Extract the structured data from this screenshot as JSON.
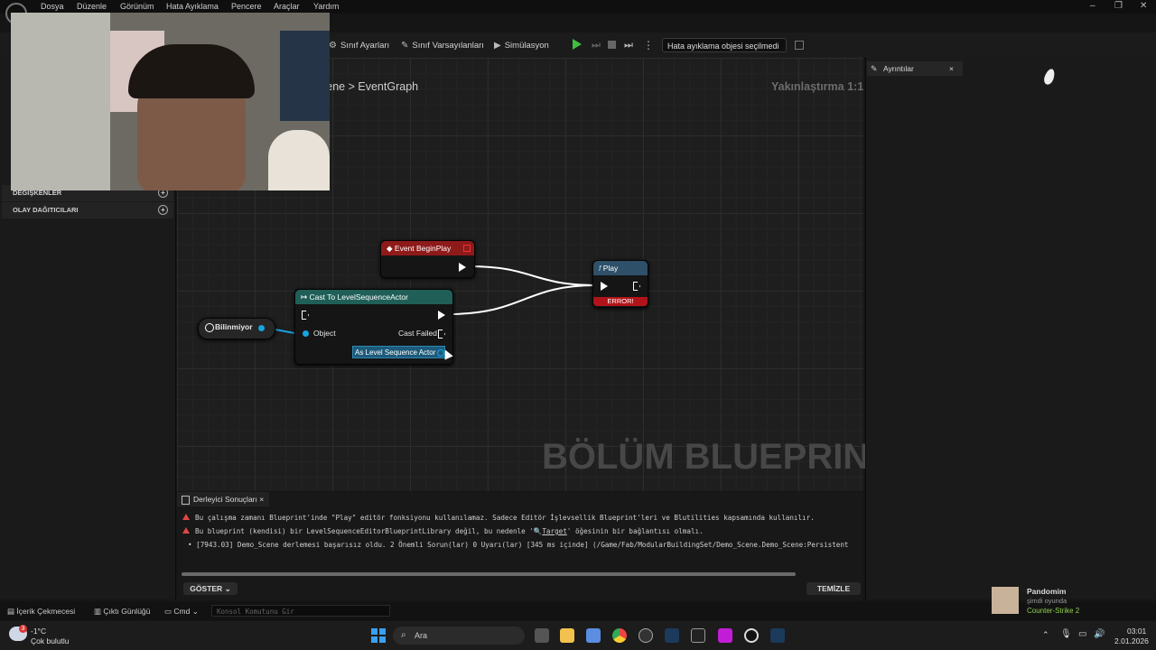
{
  "menu": [
    "Dosya",
    "Düzenle",
    "Görünüm",
    "Hata Ayıklama",
    "Pencere",
    "Araçlar",
    "Yardım"
  ],
  "window_controls": [
    "–",
    "❐",
    "✕"
  ],
  "toolbar": {
    "class_settings": "Sınıf Ayarları",
    "class_defaults": "Sınıf Varsayılanları",
    "simulation": "Simülasyon",
    "debug_object": "Hata ayıklama objesi seçilmedi"
  },
  "left_panel": {
    "variables": "DEĞİŞKENLER",
    "event_dispatchers": "OLAY DAĞITICILARI"
  },
  "graph": {
    "breadcrumb_prev": "cene",
    "breadcrumb_sep": ">",
    "breadcrumb_current": "EventGraph",
    "zoom": "Yakınlaştırma 1:1",
    "watermark": "BÖLÜM BLUEPRINT'İ"
  },
  "nodes": {
    "begin_play": {
      "title": "Event BeginPlay",
      "color": "#8e1a1a"
    },
    "play": {
      "title": "Play",
      "error": "ERROR!",
      "color": "#2e5068"
    },
    "cast": {
      "title": "Cast To LevelSequenceActor",
      "object_pin": "Object",
      "cast_failed": "Cast Failed",
      "as_output": "As Level Sequence Actor",
      "color": "#1f5f58"
    },
    "unknown": {
      "label": "Bilinmiyor"
    }
  },
  "compiler": {
    "tab": "Derleyici Sonuçları",
    "messages": [
      "Bu çalışma zamanı Blueprint'inde \"Play\" editör fonksiyonu kullanılamaz. Sadece Editör İşlevsellik Blueprint'leri ve Blutilities kapsamında kullanılır.",
      "Bu blueprint (kendisi) bir LevelSequenceEditorBlueprintLibrary değil, bu nedenle '",
      "Target",
      "' öğesinin bir bağlantısı olmalı.",
      "[7943.03] Demo_Scene derlemesi başarısız oldu. 2 Önemli Sorun(lar) 0 Uyarı(lar) [345 ms içinde] (/Game/Fab/ModularBuildingSet/Demo_Scene.Demo_Scene:Persistent"
    ],
    "show_button": "GÖSTER",
    "clear_button": "TEMİZLE"
  },
  "details": {
    "tab": "Ayrıntılar"
  },
  "statusbar": {
    "content_drawer": "İçerik Çekmecesi",
    "output_log": "Çıktı Günlüğü",
    "cmd": "Cmd",
    "console_placeholder": "Konsol Komutunu Gir"
  },
  "notification": {
    "name": "Pandomim",
    "status": "şimdi oyunda",
    "game": "Counter-Strike 2"
  },
  "taskbar": {
    "weather_temp": "-1°C",
    "weather_desc": "Çok bulutlu",
    "weather_badge": "3",
    "search": "Ara",
    "time": "03:01",
    "date": "2.01.2026"
  }
}
